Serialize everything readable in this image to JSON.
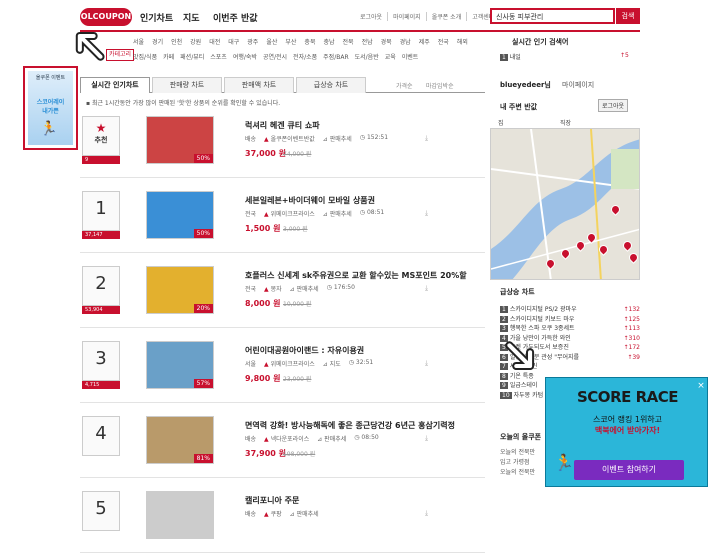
{
  "header": {
    "logo": "OLCOUPON",
    "nav": [
      "인기차트",
      "지도",
      "이번주 반값"
    ],
    "toplinks": [
      "로그아웃",
      "마이페이지",
      "올쿠폰 소개",
      "고객센터"
    ],
    "search_value": "신사동 피부관리",
    "search_button": "검색"
  },
  "regions": [
    "서울",
    "경기",
    "인천",
    "강원",
    "대전",
    "대구",
    "광주",
    "울산",
    "부산",
    "충북",
    "충남",
    "전북",
    "전남",
    "경북",
    "경남",
    "제주",
    "전국",
    "해외"
  ],
  "categories": [
    "맛집/식품",
    "카페",
    "패션/뷰티",
    "스포츠",
    "여행/숙박",
    "공연/전시",
    "전자/소품",
    "주점/BAR",
    "도서/음반",
    "교육",
    "이벤트"
  ],
  "category_tab": "카테고리",
  "tabs": [
    "실시간 인기차트",
    "판매량 차트",
    "판매액 차트",
    "급상승 차트"
  ],
  "tab_extras": [
    "가격순",
    "마감임박순"
  ],
  "notice": "최근 1시간동안 가장 많이 판매된 '핫'한 상품의 순위를 확인할 수 있습니다.",
  "rows": [
    {
      "rank": "추천",
      "badge": "9",
      "title": "럭셔리 헤겐 큐티 쇼파",
      "region": "배송",
      "seller": "올쿠폰이벤트반값",
      "tag": "판매추세",
      "time": "152:51",
      "price": "37,000 원",
      "orig": "74,000 원",
      "pct": "50%"
    },
    {
      "rank": "1",
      "badge": "37,147",
      "title": "세븐일레븐+바이더웨이 모바일 상품권",
      "region": "전국",
      "seller": "위메이크프라이스",
      "tag": "판매추세",
      "time": "08:51",
      "price": "1,500 원",
      "orig": "3,000 원",
      "pct": "50%"
    },
    {
      "rank": "2",
      "badge": "53,904",
      "title": "호플러스 신세계 sk주유권으로 교환 할수있는 MS포인트 20%할",
      "region": "전국",
      "seller": "몽자",
      "tag": "판매추세",
      "time": "176:50",
      "price": "8,000 원",
      "orig": "10,000 원",
      "pct": "20%"
    },
    {
      "rank": "3",
      "badge": "4,715",
      "title": "어린이대공원아이랜드 : 자유이용권",
      "region": "서울",
      "seller": "위메이크프라이스",
      "tag": "지도",
      "time": "32:51",
      "price": "9,800 원",
      "orig": "23,000 원",
      "pct": "57%"
    },
    {
      "rank": "4",
      "badge": "",
      "title": "면역력 강화! 방사능해독에 좋은 종근당건강 6년근 홍삼기력정",
      "region": "배송",
      "seller": "넥다운포라이스",
      "tag": "판매추세",
      "time": "08:50",
      "price": "37,900 원",
      "orig": "198,000 원",
      "pct": "81%"
    },
    {
      "rank": "5",
      "badge": "",
      "title": "캘리포니아 주문",
      "region": "배송",
      "seller": "쿠팡",
      "tag": "판매추세",
      "time": "",
      "price": "",
      "orig": "",
      "pct": ""
    }
  ],
  "right": {
    "search_rank_title": "실시간 인기 검색어",
    "search_rank_item": "내일",
    "search_rank_change": "5",
    "user": "blueyedeer님",
    "mypage": "마이페이지",
    "nearby_title": "내 주변 반값",
    "login_btn": "로그아웃",
    "map_tabs": [
      "집",
      "직장"
    ],
    "hot_title": "급상승 차트",
    "hot_items": [
      {
        "name": "스카이디지털 PS/2 광마우",
        "num": "132"
      },
      {
        "name": "스카이디지털 키보드 마우",
        "num": "125"
      },
      {
        "name": "행복한 스파 오쿠 3종세트",
        "num": "113"
      },
      {
        "name": "가을 낭만이 가득한 와인",
        "num": "310"
      },
      {
        "name": "포켓 가두되도서 보증진",
        "num": "172"
      },
      {
        "name": "일상의 기분 관성 \"무어지를",
        "num": "39"
      },
      {
        "name": "사이버클린",
        "num": ""
      },
      {
        "name": "기온 특종",
        "num": ""
      },
      {
        "name": "일급스테이",
        "num": ""
      },
      {
        "name": "자두몽 카텀",
        "num": ""
      }
    ],
    "today_title": "오늘의 올쿠폰",
    "today_items": [
      "오늘의 전북만",
      "입고 가령점",
      "오늘의 전북만"
    ]
  },
  "left_ad": {
    "line1": "올쿠폰 이벤트",
    "line2": "스코어레이",
    "line3": "내가쁜"
  },
  "popup": {
    "title": "SCORE RACE",
    "sub1": "스코어 랭킹 1위하고",
    "sub2": "맥북에어 받아가자!",
    "button": "이벤트 참여하기",
    "close": "×"
  }
}
